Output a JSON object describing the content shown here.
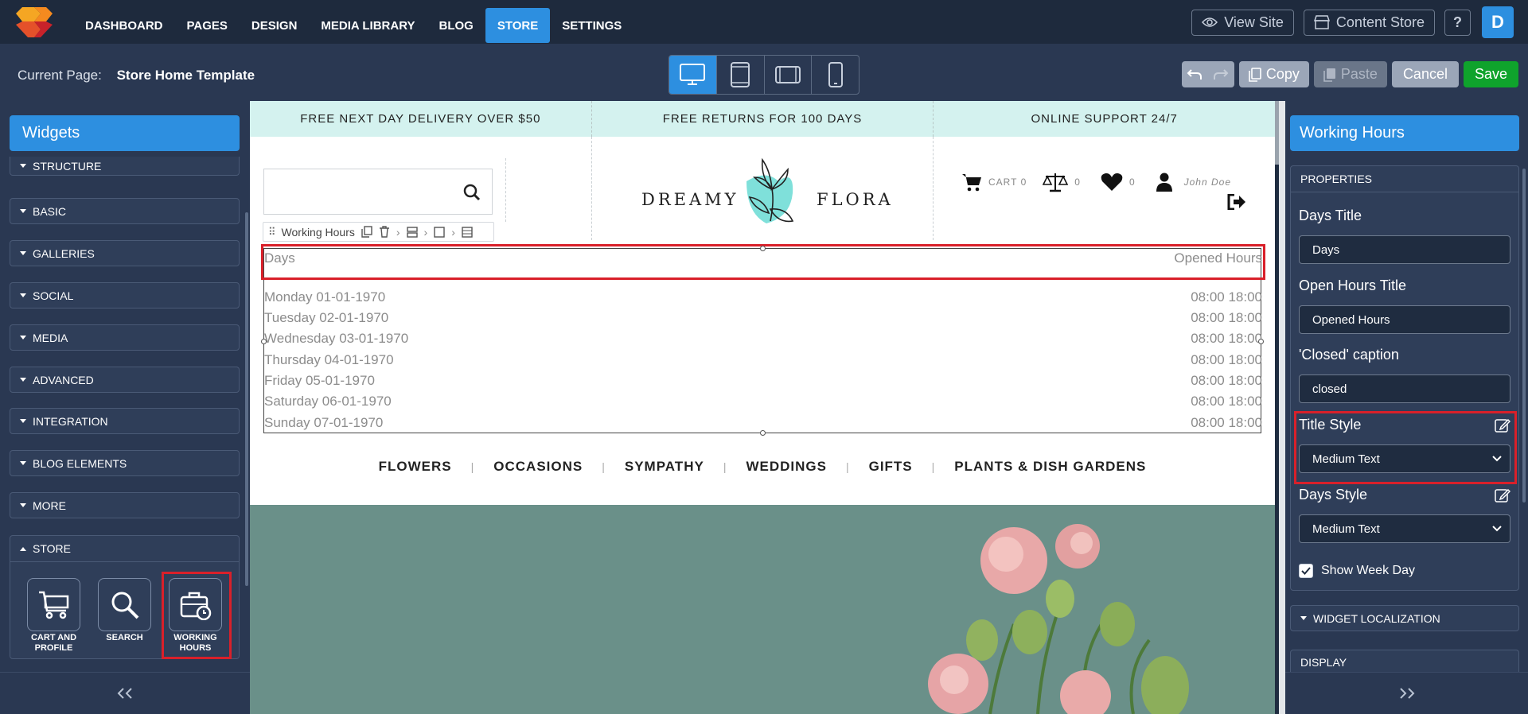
{
  "topnav": {
    "items": [
      {
        "label": "DASHBOARD"
      },
      {
        "label": "PAGES"
      },
      {
        "label": "DESIGN"
      },
      {
        "label": "MEDIA LIBRARY"
      },
      {
        "label": "BLOG"
      },
      {
        "label": "STORE",
        "active": true
      },
      {
        "label": "SETTINGS"
      }
    ],
    "view_site": "View Site",
    "content_store": "Content Store",
    "help": "?",
    "avatar": "D"
  },
  "subbar": {
    "current_page_label": "Current Page:",
    "current_page": "Store Home Template",
    "copy": "Copy",
    "paste": "Paste",
    "cancel": "Cancel",
    "save": "Save"
  },
  "left_panel": {
    "title": "Widgets",
    "categories": [
      {
        "label": "STRUCTURE"
      },
      {
        "label": "BASIC"
      },
      {
        "label": "GALLERIES"
      },
      {
        "label": "SOCIAL"
      },
      {
        "label": "MEDIA"
      },
      {
        "label": "ADVANCED"
      },
      {
        "label": "INTEGRATION"
      },
      {
        "label": "BLOG ELEMENTS"
      },
      {
        "label": "MORE"
      }
    ],
    "store": {
      "label": "STORE",
      "widgets": [
        {
          "label": "CART AND PROFILE",
          "icon": "cart-icon"
        },
        {
          "label": "SEARCH",
          "icon": "search-icon"
        },
        {
          "label": "WORKING HOURS",
          "icon": "briefcase-clock-icon"
        }
      ]
    }
  },
  "canvas": {
    "promo": [
      "FREE NEXT DAY DELIVERY OVER $50",
      "FREE RETURNS FOR 100 DAYS",
      "ONLINE SUPPORT 24/7"
    ],
    "brand_left": "DREAMY",
    "brand_right": "FLORA",
    "cart": "CART 0",
    "compare_count": "0",
    "wishlist_count": "0",
    "user_name": "John Doe",
    "widget_toolbar_label": "Working Hours",
    "working_hours": {
      "days_title": "Days",
      "hours_title": "Opened Hours",
      "rows": [
        {
          "day": "Monday 01-01-1970",
          "hours": "08:00 18:00"
        },
        {
          "day": "Tuesday 02-01-1970",
          "hours": "08:00 18:00"
        },
        {
          "day": "Wednesday 03-01-1970",
          "hours": "08:00 18:00"
        },
        {
          "day": "Thursday 04-01-1970",
          "hours": "08:00 18:00"
        },
        {
          "day": "Friday 05-01-1970",
          "hours": "08:00 18:00"
        },
        {
          "day": "Saturday 06-01-1970",
          "hours": "08:00 18:00"
        },
        {
          "day": "Sunday 07-01-1970",
          "hours": "08:00 18:00"
        }
      ]
    },
    "menu": [
      "FLOWERS",
      "OCCASIONS",
      "SYMPATHY",
      "WEDDINGS",
      "GIFTS",
      "PLANTS & DISH GARDENS"
    ]
  },
  "right_panel": {
    "title": "Working Hours",
    "properties_label": "PROPERTIES",
    "days_title_label": "Days Title",
    "days_title_value": "Days",
    "open_hours_title_label": "Open Hours Title",
    "open_hours_title_value": "Opened Hours",
    "closed_caption_label": "'Closed' caption",
    "closed_caption_value": "closed",
    "title_style_label": "Title Style",
    "title_style_value": "Medium Text",
    "days_style_label": "Days Style",
    "days_style_value": "Medium Text",
    "show_week_day_label": "Show Week Day",
    "show_week_day": true,
    "widget_localization": "WIDGET LOCALIZATION",
    "display": "DISPLAY"
  },
  "colors": {
    "accent": "#2d8fe0",
    "save": "#0fa32c",
    "highlight": "#d9202a",
    "promo_bg": "#d4f2ef",
    "panel_bg": "#2a3852"
  }
}
